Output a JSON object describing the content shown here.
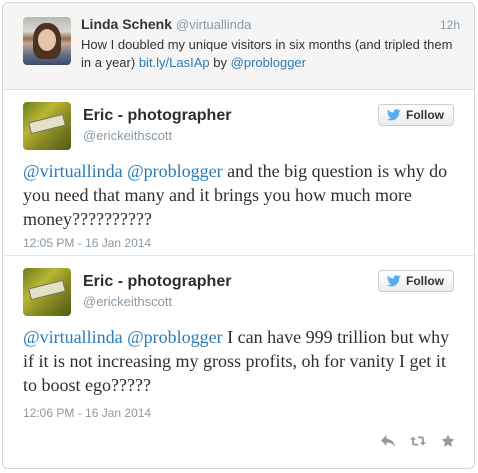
{
  "parent_tweet": {
    "name": "Linda Schenk",
    "handle": "@virtuallinda",
    "time": "12h",
    "text_prefix": "How I doubled my unique visitors in six months (and tripled them in a year)",
    "link": "bit.ly/LasIAp",
    "by_word": "by",
    "mention": "@problogger"
  },
  "follow_label": "Follow",
  "tweets": [
    {
      "name": "Eric - photographer",
      "handle": "@erickeithscott",
      "mention1": "@virtuallinda",
      "mention2": "@problogger",
      "text": "and the big question is why do you need that many and it brings you how much more money??????????",
      "timestamp": "12:05 PM - 16 Jan 2014"
    },
    {
      "name": "Eric - photographer",
      "handle": "@erickeithscott",
      "mention1": "@virtuallinda",
      "mention2": "@problogger",
      "text": "I can have 999 trillion but why if it is not increasing my gross profits, oh for vanity I get it to boost ego?????",
      "timestamp": "12:06 PM - 16 Jan 2014"
    }
  ],
  "actions": {
    "reply_icon": "reply-icon",
    "retweet_icon": "retweet-icon",
    "favorite_icon": "star-icon"
  },
  "colors": {
    "link": "#2b7bb9",
    "twitter_bird": "#55acee",
    "muted": "#8899a6"
  }
}
